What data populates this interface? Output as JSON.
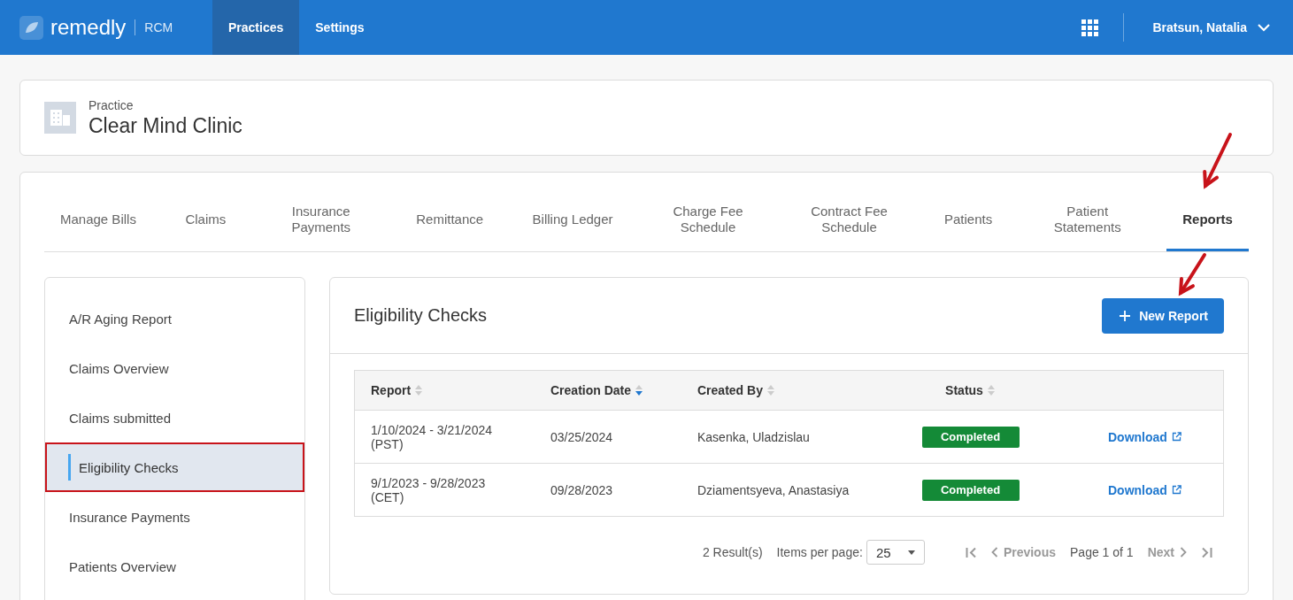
{
  "header": {
    "brand": "remedly",
    "product": "RCM",
    "nav": [
      {
        "label": "Practices",
        "selected": true
      },
      {
        "label": "Settings",
        "selected": false
      }
    ],
    "user": "Bratsun, Natalia"
  },
  "practice": {
    "label": "Practice",
    "name": "Clear Mind Clinic"
  },
  "tabs": [
    {
      "label": "Manage Bills",
      "selected": false
    },
    {
      "label": "Claims",
      "selected": false
    },
    {
      "label": "Insurance Payments",
      "selected": false
    },
    {
      "label": "Remittance",
      "selected": false
    },
    {
      "label": "Billing Ledger",
      "selected": false
    },
    {
      "label": "Charge Fee Schedule",
      "selected": false
    },
    {
      "label": "Contract Fee Schedule",
      "selected": false
    },
    {
      "label": "Patients",
      "selected": false
    },
    {
      "label": "Patient Statements",
      "selected": false
    },
    {
      "label": "Reports",
      "selected": true,
      "annotated": true
    }
  ],
  "sidebar": {
    "items": [
      {
        "label": "A/R Aging Report",
        "selected": false,
        "annotated": false
      },
      {
        "label": "Claims Overview",
        "selected": false,
        "annotated": false
      },
      {
        "label": "Claims submitted",
        "selected": false,
        "annotated": false
      },
      {
        "label": "Eligibility Checks",
        "selected": true,
        "annotated": true
      },
      {
        "label": "Insurance Payments",
        "selected": false,
        "annotated": false
      },
      {
        "label": "Patients Overview",
        "selected": false,
        "annotated": false
      }
    ]
  },
  "panel": {
    "title": "Eligibility Checks",
    "new_button": {
      "label": "New Report",
      "annotated": true
    },
    "table": {
      "columns": [
        {
          "label": "Report",
          "sorted": false
        },
        {
          "label": "Creation Date",
          "sorted": true
        },
        {
          "label": "Created By",
          "sorted": false
        },
        {
          "label": "Status",
          "sorted": false
        }
      ],
      "rows": [
        {
          "report": "1/10/2024 - 3/21/2024",
          "zone": "(PST)",
          "created": "03/25/2024",
          "by": "Kasenka, Uladzislau",
          "status": "Completed",
          "action": "Download"
        },
        {
          "report": "9/1/2023 - 9/28/2023",
          "zone": "(CET)",
          "created": "09/28/2023",
          "by": "Dziamentsyeva, Anastasiya",
          "status": "Completed",
          "action": "Download"
        }
      ]
    },
    "pagination": {
      "results": "2 Result(s)",
      "per_page_label": "Items per page:",
      "per_page": "25",
      "previous": {
        "label": "Previous",
        "disabled": true
      },
      "page": "Page 1 of 1",
      "next": {
        "label": "Next",
        "disabled": true
      },
      "first_disabled": true,
      "last_disabled": true
    }
  }
}
